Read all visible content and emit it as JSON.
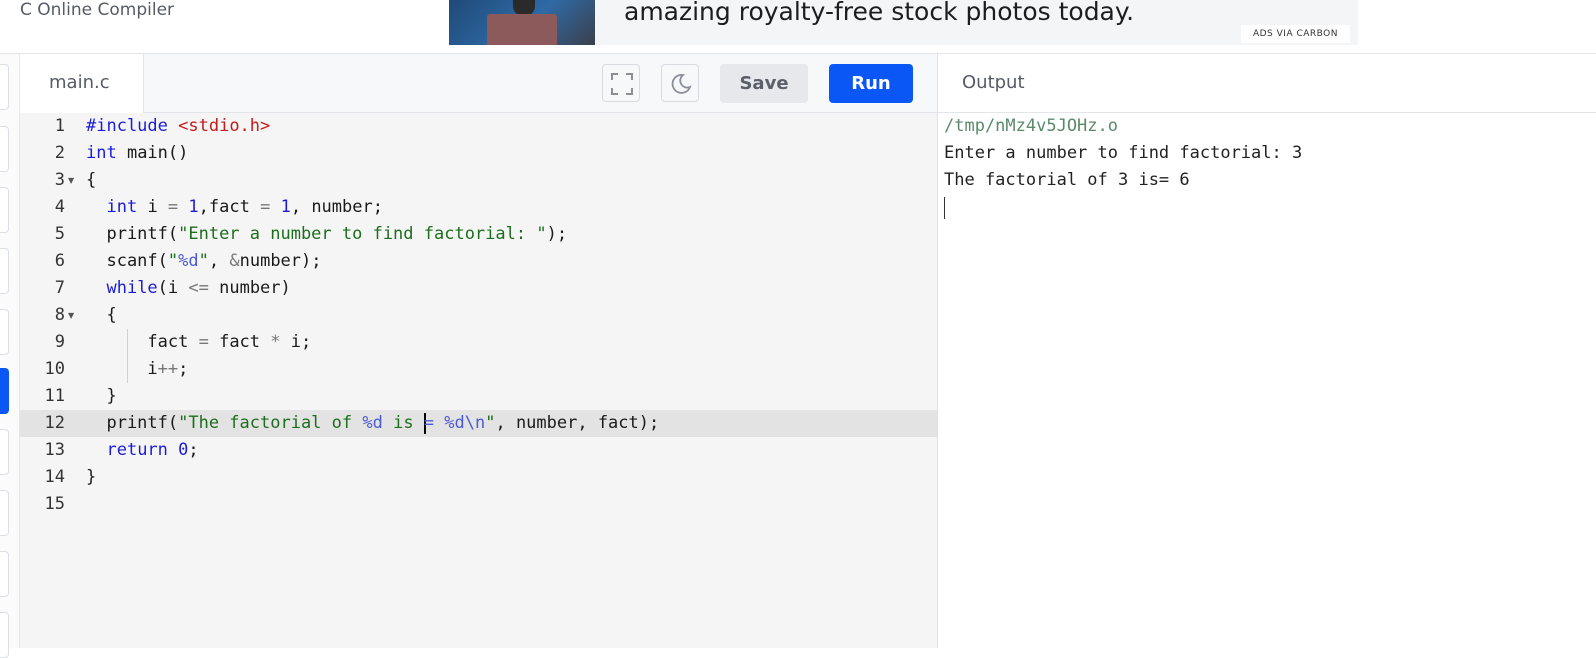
{
  "header": {
    "site_title": "C Online Compiler",
    "ad": {
      "text": "amazing royalty-free stock photos today.",
      "badge": "ADS VIA CARBON"
    }
  },
  "editor": {
    "file_tab": "main.c",
    "buttons": {
      "fullscreen_icon": "expand-icon",
      "theme_icon": "moon-icon",
      "save": "Save",
      "run": "Run"
    },
    "current_line": 12,
    "line_numbers": [
      "1",
      "2",
      "3",
      "4",
      "5",
      "6",
      "7",
      "8",
      "9",
      "10",
      "11",
      "12",
      "13",
      "14",
      "15"
    ],
    "lines": [
      "#include <stdio.h>",
      "int main()",
      "{",
      "  int i = 1,fact = 1, number;",
      "  printf(\"Enter a number to find factorial: \");",
      "  scanf(\"%d\", &number);",
      "  while(i <= number)",
      "  {",
      "      fact = fact * i;",
      "      i++;",
      "  }",
      "  printf(\"The factorial of %d is = %d\\n\", number, fact);",
      "  return 0;",
      "}",
      ""
    ]
  },
  "output": {
    "title": "Output",
    "lines": [
      "/tmp/nMz4v5JOHz.o",
      "Enter a number to find factorial: 3",
      "The factorial of 3 is= 6"
    ]
  },
  "colors": {
    "accent": "#0b57f5",
    "string": "#1c6e1c",
    "keyword": "#1c1cd6",
    "include": "#c41a1a"
  }
}
